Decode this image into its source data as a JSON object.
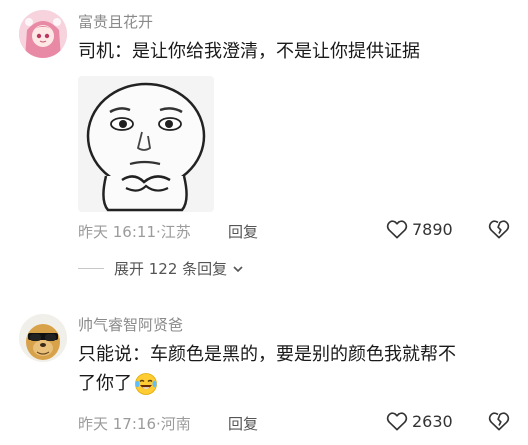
{
  "comments": [
    {
      "username": "富贵且花开",
      "text": "司机：是让你给我澄清，不是让你提供证据",
      "time": "昨天 16:11",
      "location": "江苏",
      "reply_label": "回复",
      "likes": "7890",
      "expand_label": "展开 122 条回复"
    },
    {
      "username": "帅气睿智阿贤爸",
      "text_line1": "只能说：车颜色是黑的，要是别的颜色我就帮不",
      "text_line2": "了你了",
      "time": "昨天 17:16",
      "location": "河南",
      "reply_label": "回复",
      "likes": "2630"
    }
  ],
  "separator": "·"
}
